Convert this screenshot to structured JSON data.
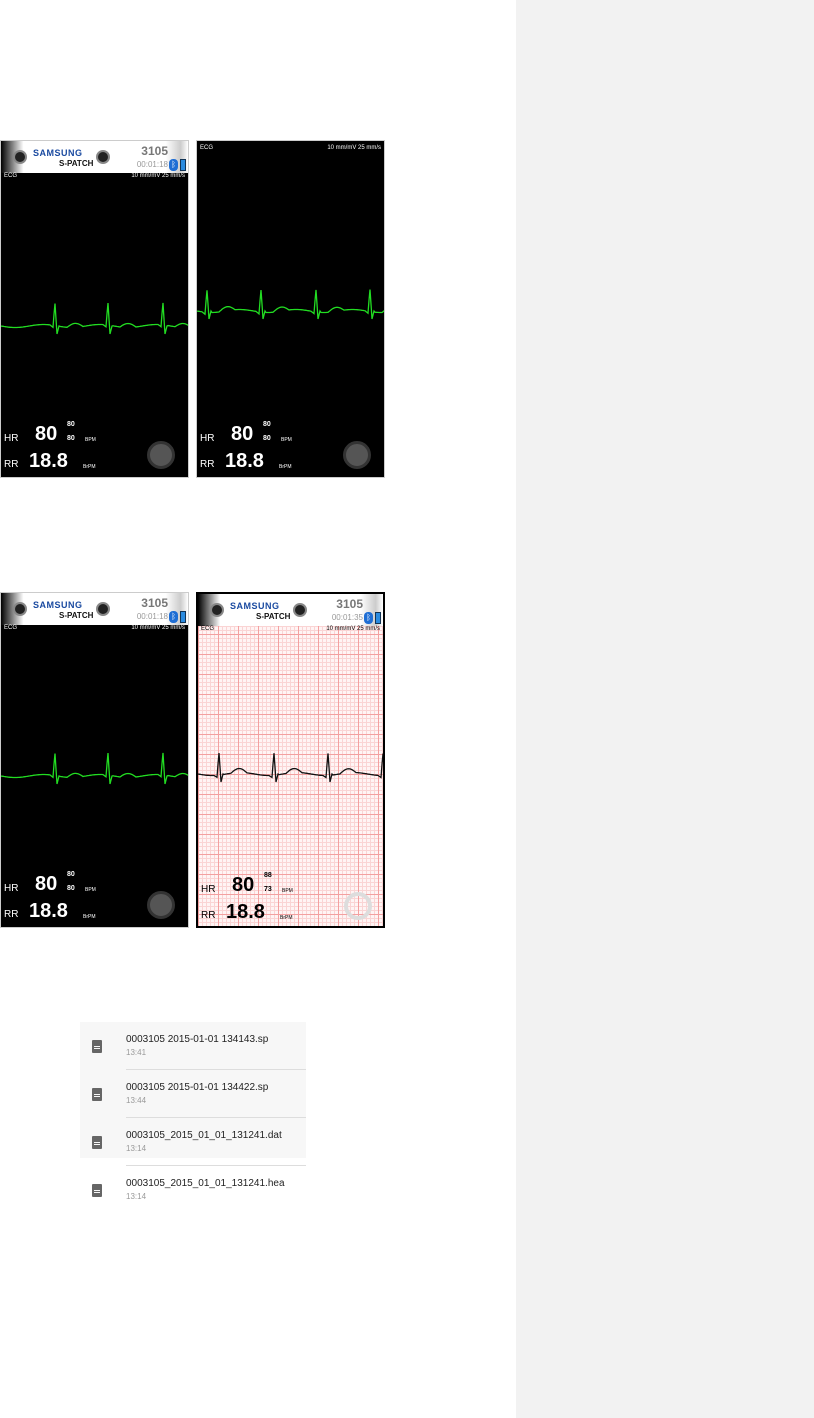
{
  "device": {
    "brand": "SAMSUNG",
    "model": "S-PATCH",
    "patient_id": "3105",
    "bluetooth_icon": "bluetooth-icon",
    "battery_icon": "battery-icon"
  },
  "panels": [
    {
      "has_header": true,
      "timer": "00:01:18",
      "lead": "ECG",
      "scale": "10 mm/mV 25 mm/s",
      "hr_label": "HR",
      "hr": "80",
      "hr_max": "80",
      "hr_min": "80",
      "hr_unit": "BPM",
      "rr_label": "RR",
      "rr": "18.8",
      "rr_unit": "BrPM",
      "trace_color": "#22dd22"
    },
    {
      "has_header": false,
      "lead": "ECG",
      "scale": "10 mm/mV 25 mm/s",
      "hr_label": "HR",
      "hr": "80",
      "hr_max": "80",
      "hr_min": "80",
      "hr_unit": "BPM",
      "rr_label": "RR",
      "rr": "18.8",
      "rr_unit": "BrPM",
      "trace_color": "#22dd22"
    },
    {
      "has_header": true,
      "timer": "00:01:18",
      "lead": "ECG",
      "scale": "10 mm/mV 25 mm/s",
      "hr_label": "HR",
      "hr": "80",
      "hr_max": "80",
      "hr_min": "80",
      "hr_unit": "BPM",
      "rr_label": "RR",
      "rr": "18.8",
      "rr_unit": "BrPM",
      "trace_color": "#22dd22"
    },
    {
      "has_header": true,
      "timer": "00:01:35",
      "lead": "ECG",
      "scale": "10 mm/mV 25 mm/s",
      "hr_label": "HR",
      "hr": "80",
      "hr_max": "88",
      "hr_min": "73",
      "hr_unit": "BPM",
      "rr_label": "RR",
      "rr": "18.8",
      "rr_unit": "BrPM",
      "trace_color": "#111111"
    }
  ],
  "files": [
    {
      "name": "0003105 2015-01-01 134143.sp",
      "time": "13:41",
      "icon": "file-icon"
    },
    {
      "name": "0003105 2015-01-01 134422.sp",
      "time": "13:44",
      "icon": "file-icon"
    },
    {
      "name": "0003105_2015_01_01_131241.dat",
      "time": "13:14",
      "icon": "file-icon"
    },
    {
      "name": "0003105_2015_01_01_131241.hea",
      "time": "13:14",
      "icon": "file-icon"
    }
  ]
}
